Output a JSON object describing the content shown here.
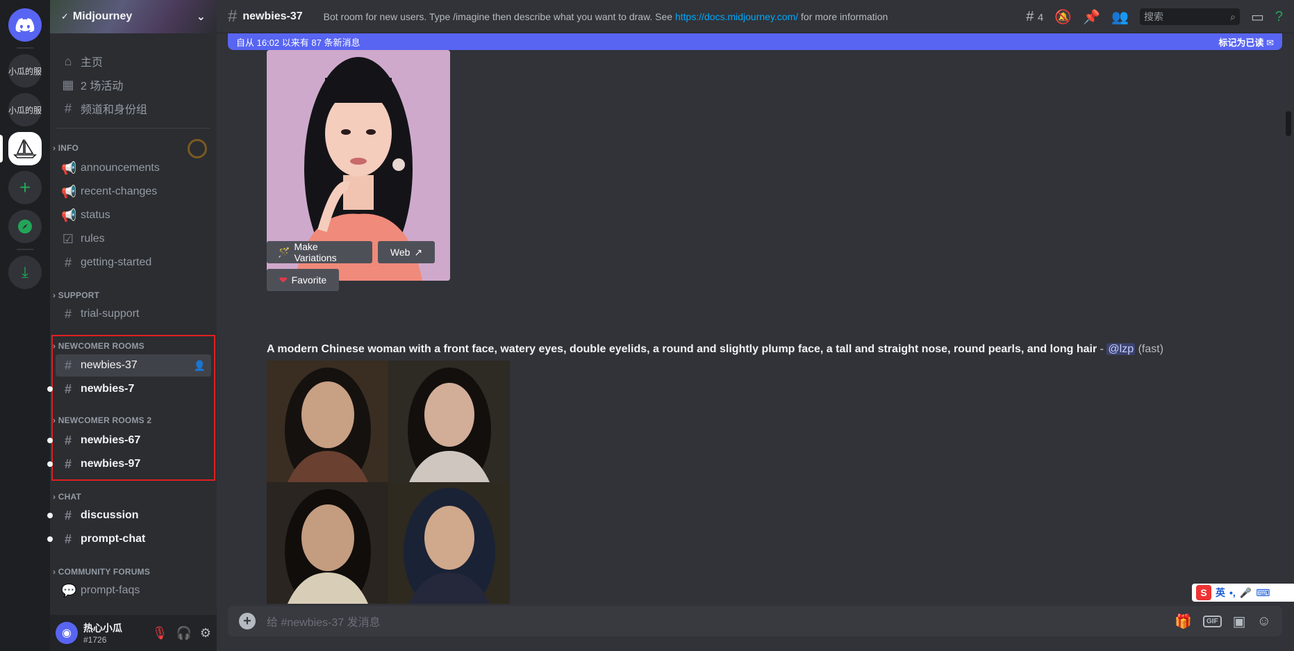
{
  "server_rail": {
    "servers": [
      {
        "label": "小瓜的服"
      },
      {
        "label": "小瓜的服"
      }
    ]
  },
  "guild": {
    "name": "Midjourney"
  },
  "nav": {
    "home": "主页",
    "events": "2 场活动",
    "channels_roles": "频道和身份组"
  },
  "categories": {
    "info": "INFO",
    "support": "SUPPORT",
    "newcomer": "NEWCOMER ROOMS",
    "newcomer2": "NEWCOMER ROOMS 2",
    "chat": "CHAT",
    "forums": "COMMUNITY FORUMS"
  },
  "channels": {
    "announcements": "announcements",
    "recent_changes": "recent-changes",
    "status": "status",
    "rules": "rules",
    "getting_started": "getting-started",
    "trial_support": "trial-support",
    "newbies_37": "newbies-37",
    "newbies_7": "newbies-7",
    "newbies_67": "newbies-67",
    "newbies_97": "newbies-97",
    "discussion": "discussion",
    "prompt_chat": "prompt-chat",
    "prompt_faqs": "prompt-faqs"
  },
  "user": {
    "name": "热心小瓜",
    "tag": "#1726"
  },
  "header": {
    "channel": "newbies-37",
    "topic_before": "Bot room for new users. Type /imagine then describe what you want to draw. See ",
    "topic_link": "https://docs.midjourney.com/",
    "topic_after": " for more information",
    "threads_count": "4",
    "search_placeholder": "搜索"
  },
  "new_messages": {
    "text": "自从 16:02 以来有 87 条新消息",
    "mark_read": "标记为已读"
  },
  "message": {
    "make_variations": "Make Variations",
    "web": "Web",
    "favorite": "Favorite",
    "prompt": "A modern Chinese woman with a front face, watery eyes, double eyelids, a round and slightly plump face, a tall and straight nose, round pearls, and long hair",
    "separator": " - ",
    "mention": "@lzp",
    "mode": "(fast)"
  },
  "composer": {
    "placeholder": "给 #newbies-37 发消息",
    "gif": "GIF"
  },
  "ime": {
    "lang": "英"
  },
  "colors": {
    "accent": "#5865f2",
    "link": "#00a8fc",
    "highlight_box": "#e02020"
  }
}
